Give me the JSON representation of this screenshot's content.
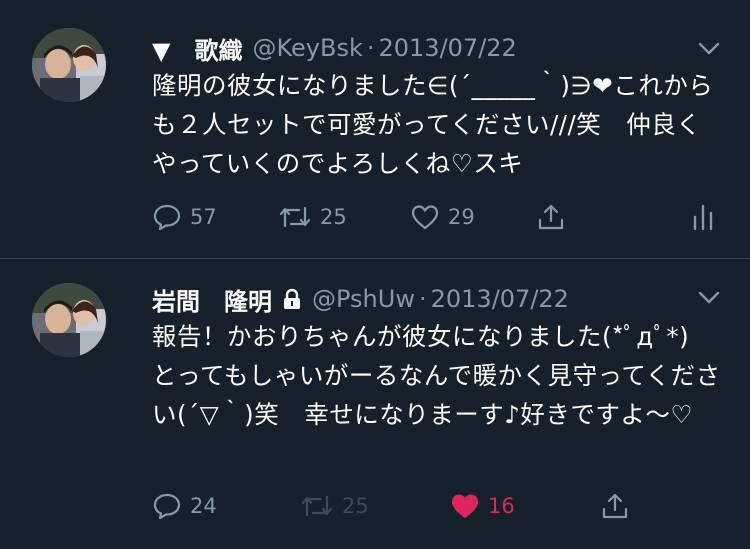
{
  "tweets": [
    {
      "name": "▼　歌織",
      "handle": "@KeyBsk",
      "separator": "·",
      "date": "2013/07/22",
      "text": "隆明の彼女になりました∈(´_____｀)∋❤︎これからも２人セットで可愛がってください///笑　仲良くやっていくのでよろしくね♡スキ",
      "replies": "57",
      "retweets": "25",
      "likes": "29",
      "locked": false
    },
    {
      "name": "岩間　隆明",
      "handle": "@PshUw",
      "separator": "·",
      "date": "2013/07/22",
      "text": "報告！かおりちゃんが彼女になりました(*ﾟдﾟ*)　とってもしゃいがーるなんで暖かく見守ってください(´▽｀)笑　幸せになりまーす♪好きですよ〜♡",
      "replies": "24",
      "retweets": "25",
      "likes": "16",
      "locked": true
    }
  ],
  "colors": {
    "background": "#15202b",
    "secondary_text": "#8899a6",
    "like_active": "#e0245e",
    "divider": "#38444d"
  }
}
